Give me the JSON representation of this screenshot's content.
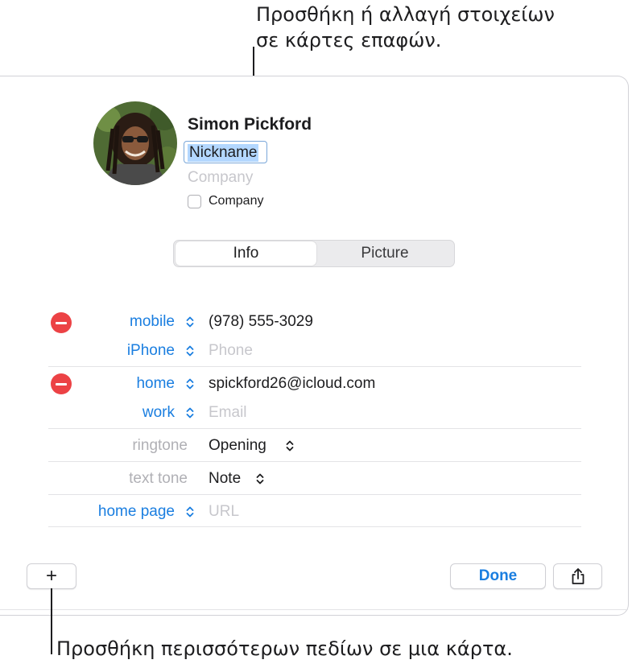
{
  "callouts": {
    "top_line1": "Προσθήκη ή αλλαγή στοιχείων",
    "top_line2": "σε κάρτες επαφών.",
    "bottom": "Προσθήκη περισσότερων πεδίων σε μια κάρτα."
  },
  "contact": {
    "name": "Simon  Pickford",
    "nickname_value": "Nickname",
    "company_placeholder": "Company",
    "company_checkbox_label": "Company",
    "company_checked": false
  },
  "tabs": {
    "info": "Info",
    "picture": "Picture",
    "selected": "Info"
  },
  "fields": {
    "mobile_label": "mobile",
    "mobile_value": "(978) 555-3029",
    "iphone_label": "iPhone",
    "iphone_placeholder": "Phone",
    "home_label": "home",
    "home_value": "spickford26@icloud.com",
    "work_label": "work",
    "work_placeholder": "Email",
    "ringtone_label": "ringtone",
    "ringtone_value": "Opening",
    "texttone_label": "text tone",
    "texttone_value": "Note",
    "homepage_label": "home page",
    "homepage_placeholder": "URL"
  },
  "buttons": {
    "add": "+",
    "done": "Done",
    "share_icon": "share-icon"
  },
  "colors": {
    "accent": "#1a7ee0",
    "delete": "#ec4245",
    "selection": "#b3d7ff"
  }
}
